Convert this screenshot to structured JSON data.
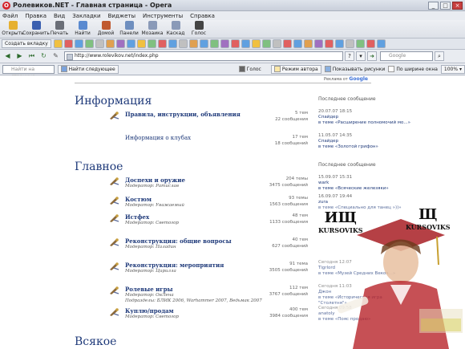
{
  "window": {
    "title": "Ролевиков.NET - Главная страница - Opera",
    "app_icon": "opera-o-icon",
    "controls": [
      "_",
      "□",
      "×"
    ]
  },
  "menu": [
    "Файл",
    "Правка",
    "Вид",
    "Закладки",
    "Виджеты",
    "Инструменты",
    "Справка"
  ],
  "toolbar": [
    {
      "label": "Открыть",
      "icon": "folder-open-icon",
      "color": "#e6b030"
    },
    {
      "label": "Сохранить",
      "icon": "save-disk-icon",
      "color": "#3a5fb0"
    },
    {
      "label": "Печать",
      "icon": "printer-icon",
      "color": "#6b6f78"
    },
    {
      "label": "Найти",
      "icon": "magnifier-icon",
      "color": "#5a8ad0"
    },
    {
      "label": "Домой",
      "icon": "home-icon",
      "color": "#c05a30"
    },
    {
      "label": "Панели",
      "icon": "panels-icon",
      "color": "#6f8fbf"
    },
    {
      "label": "Мозаика",
      "icon": "tile-icon",
      "color": "#8a9ab8"
    },
    {
      "label": "Каскад",
      "icon": "cascade-icon",
      "color": "#8a9ab8"
    },
    {
      "label": "Голос",
      "icon": "voice-icon",
      "color": "#444444"
    }
  ],
  "tabbar": {
    "new_tab_label": "Создать вкладку"
  },
  "address": {
    "url": "http://www.rolevikov.net/index.php",
    "search_placeholder": "Google",
    "help_label": "?"
  },
  "findbar": {
    "placeholder": "Найти на странице",
    "find_next": "Найти следующее",
    "voice": "Голос",
    "author_mode": "Режим автора",
    "show_images": "Показывать рисунки",
    "fit_width": "По ширине окна",
    "zoom": "100%"
  },
  "page": {
    "ad_label": "Реклама от",
    "ad_brand": "Google",
    "sections": [
      {
        "title": "Информация",
        "last_post_header": "Последнее сообщение",
        "forums": [
          {
            "name": "Правила, инструкции, объявления",
            "topics": "5 тем",
            "posts": "22 сообщения",
            "last": {
              "date": "20.07.07 18:15",
              "user": "Спайдер",
              "topic": "в теме «Расширение полномочий мо...»"
            }
          },
          {
            "name": "Информация о клубах",
            "plain": true,
            "topics": "17 тем",
            "posts": "18 сообщений",
            "last": {
              "date": "11.05.07 14:35",
              "user": "Спайдер",
              "topic": "в теме «Золотой грифон»"
            }
          }
        ]
      },
      {
        "title": "Главное",
        "last_post_header": "Последнее сообщение",
        "forums": [
          {
            "name": "Доспехи и оружие",
            "mod_label": "Модератор:",
            "mod": "Ратислав",
            "topics": "204 темы",
            "posts": "3475 сообщений",
            "last": {
              "date": "15.09.07 15:31",
              "user": "wark",
              "topic": "в теме «Всяческие железяки»"
            }
          },
          {
            "name": "Костюм",
            "mod_label": "Модератор:",
            "mod": "Уважаемый",
            "topics": "93 темы",
            "posts": "1563 сообщения",
            "last": {
              "date": "16.09.07 19:44",
              "user": "zura",
              "topic": "в теме «Специально для танец »))»"
            }
          },
          {
            "name": "Истфех",
            "mod_label": "Модератор:",
            "mod": "Светогор",
            "topics": "48 тем",
            "posts": "1133 сообщения",
            "last": {
              "date": "",
              "user": "",
              "topic": ""
            }
          },
          {
            "name": "Реконструкция: общие вопросы",
            "mod_label": "Модератор:",
            "mod": "Паладин",
            "topics": "40 тем",
            "posts": "627 сообщений",
            "last": {
              "date": "",
              "user": "",
              "topic": ""
            }
          },
          {
            "name": "Реконструкция: мероприятия",
            "mod_label": "Модератор:",
            "mod": "Цирилла",
            "topics": "91 тема",
            "posts": "3505 сообщений",
            "last": {
              "date": "Сегодня 12:07",
              "user": "Tigrlord",
              "topic": "в теме «Музей Средних Веков...»"
            }
          },
          {
            "name": "Ролевые игры",
            "mod_label": "Модератор:",
            "mod": "ОвЛена",
            "sub_label": "Подразделы:",
            "sub": "БЛИК 2006, Warhammer 2007, Ведьмак 2007",
            "topics": "112 тем",
            "posts": "3767 сообщений",
            "last": {
              "date": "Сегодня 11:03",
              "user": "Джон",
              "topic": "в теме «Историческая игра \"Столетня\"»"
            }
          },
          {
            "name": "Куплю/продам",
            "mod_label": "Модератор:",
            "mod": "Светогор",
            "topics": "400 тем",
            "posts": "3984 сообщения",
            "last": {
              "date": "Сегодня 09:58",
              "user": "anatoly",
              "topic": "в теме «Пояс продаю»"
            }
          }
        ]
      },
      {
        "title": "Всякое",
        "forums": []
      }
    ]
  },
  "watermark": {
    "left_big": "ИЩ",
    "left_small": "KURSOVIKS",
    "right_big": "Щ",
    "right_small": "KURSOVIKS"
  }
}
